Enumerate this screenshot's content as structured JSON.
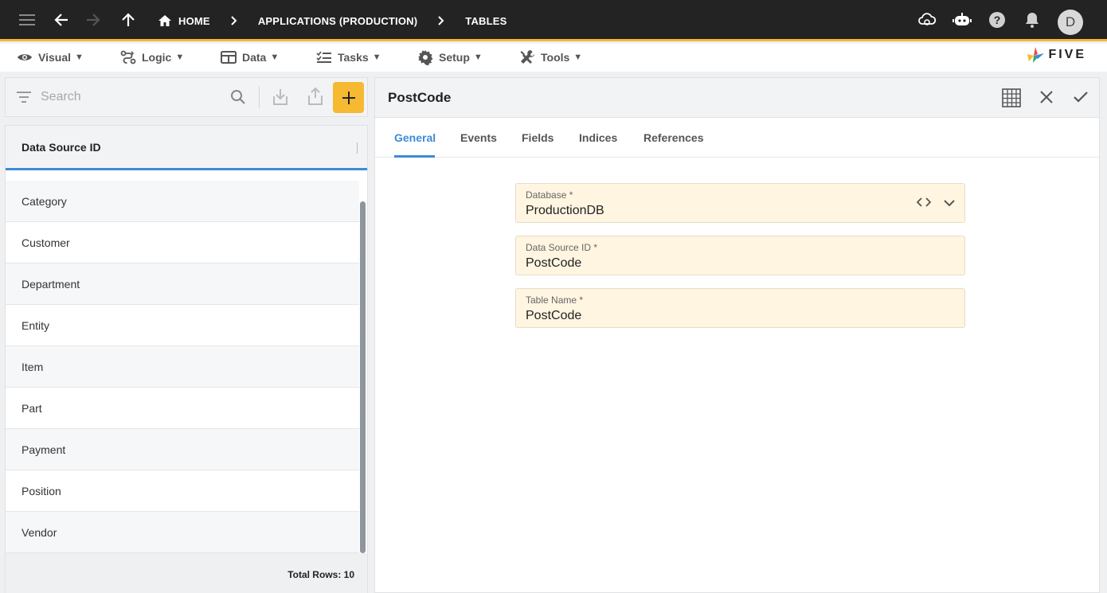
{
  "topbar": {
    "breadcrumbs": [
      "HOME",
      "APPLICATIONS (PRODUCTION)",
      "TABLES"
    ],
    "avatar_initial": "D"
  },
  "menu": {
    "items": [
      {
        "label": "Visual",
        "icon": "eye-icon"
      },
      {
        "label": "Logic",
        "icon": "logic-icon"
      },
      {
        "label": "Data",
        "icon": "table-icon"
      },
      {
        "label": "Tasks",
        "icon": "tasks-icon"
      },
      {
        "label": "Setup",
        "icon": "gear-icon"
      },
      {
        "label": "Tools",
        "icon": "tools-icon"
      }
    ],
    "logo_text": "FIVE"
  },
  "left": {
    "search_placeholder": "Search",
    "column_header": "Data Source ID",
    "rows": [
      "Category",
      "Customer",
      "Department",
      "Entity",
      "Item",
      "Part",
      "Payment",
      "Position",
      "Vendor"
    ],
    "total_rows": "Total Rows: 10"
  },
  "detail": {
    "title": "PostCode",
    "tabs": [
      "General",
      "Events",
      "Fields",
      "Indices",
      "References"
    ],
    "active_tab": "General",
    "fields": [
      {
        "label": "Database *",
        "value": "ProductionDB"
      },
      {
        "label": "Data Source ID *",
        "value": "PostCode"
      },
      {
        "label": "Table Name *",
        "value": "PostCode"
      }
    ]
  },
  "colors": {
    "topbar": "#232323",
    "accent": "#f6b932",
    "tab_active": "#3d8bd4",
    "field_bg": "#fff5e1",
    "add_button": "#f6b932"
  }
}
